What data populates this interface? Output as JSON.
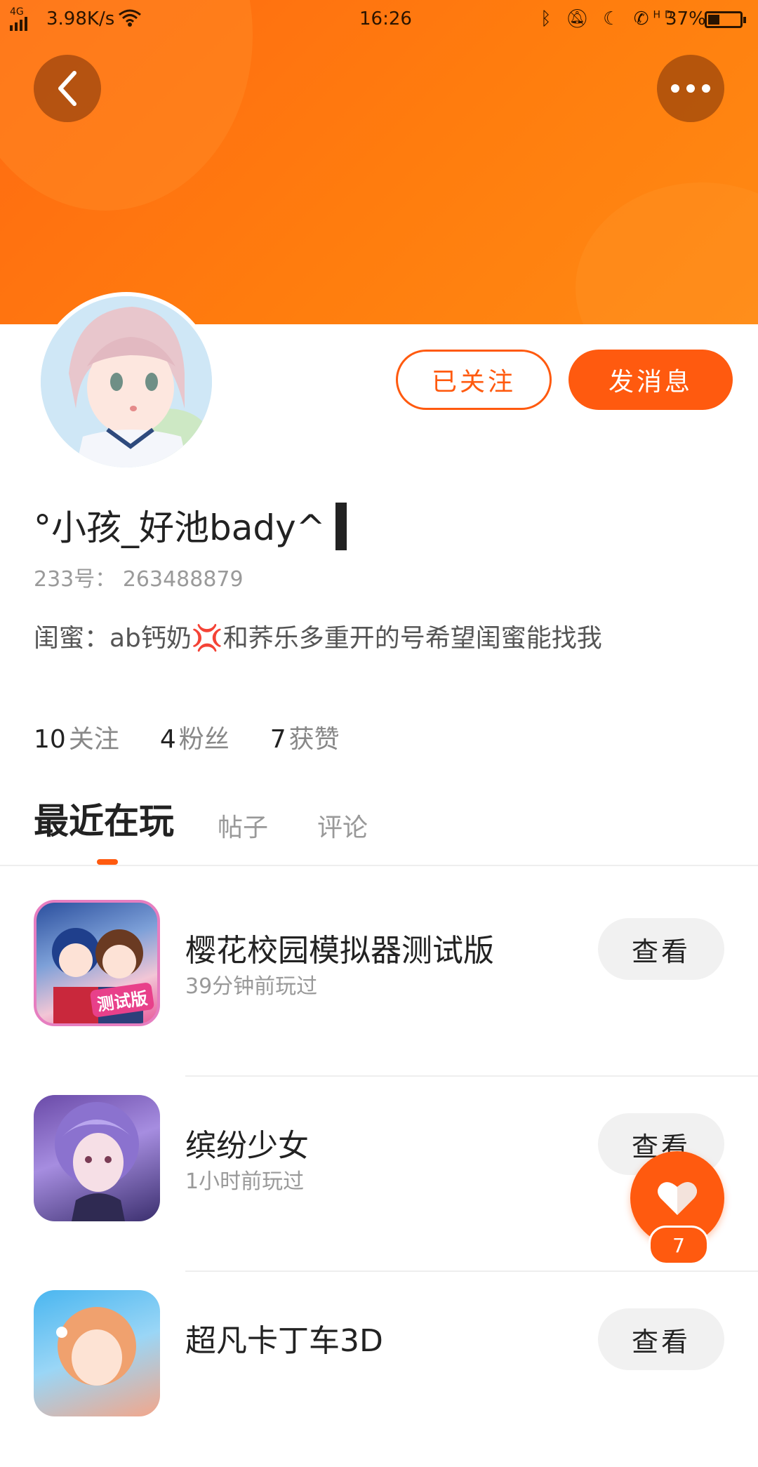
{
  "status_bar": {
    "network": "4G",
    "speed": "3.98K/s",
    "time": "16:26",
    "icons": [
      "bluetooth-icon",
      "mute-icon",
      "moon-icon",
      "hd-call-icon"
    ],
    "hd_label": "HD",
    "battery": "37%",
    "battery_level": 0.37
  },
  "header": {
    "accent": "#ff5a0f",
    "back_icon": "‹"
  },
  "profile": {
    "follow_label": "已关注",
    "message_label": "发消息",
    "nickname": "°小孩_好池bady^",
    "uid_label": "233号：",
    "uid_value": "263488879",
    "bio": "闺蜜：ab钙奶💢和荞乐多重开的号希望闺蜜能找我",
    "stats": [
      {
        "num": "10",
        "label": "关注"
      },
      {
        "num": "4",
        "label": "粉丝"
      },
      {
        "num": "7",
        "label": "获赞"
      }
    ]
  },
  "tabs": [
    {
      "label": "最近在玩"
    },
    {
      "label": "帖子"
    },
    {
      "label": "评论"
    }
  ],
  "games": [
    {
      "title": "樱花校园模拟器测试版",
      "time": "39分钟前玩过",
      "button": "查看",
      "tag": "测试版"
    },
    {
      "title": "缤纷少女",
      "time": "1小时前玩过",
      "button": "查看"
    },
    {
      "title": "超凡卡丁车3D",
      "time": "",
      "button": "查看"
    }
  ],
  "fab": {
    "icon": "heart-icon",
    "count": "7"
  }
}
